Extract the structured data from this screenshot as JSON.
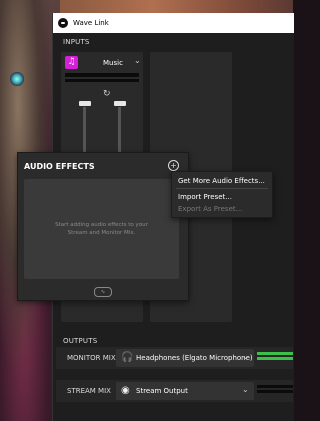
{
  "window": {
    "title": "Wave Link"
  },
  "sections": {
    "inputs": "INPUTS",
    "outputs": "OUTPUTS"
  },
  "input_channel": {
    "name": "Music",
    "icon": "music-note-icon",
    "accent": "#d81fd8"
  },
  "audio_effects": {
    "title": "AUDIO EFFECTS",
    "hint": "Start adding audio effects to your Stream and Monitor Mix."
  },
  "context_menu": {
    "items": [
      {
        "label": "Get More Audio Effects...",
        "enabled": true
      },
      {
        "label": "Import Preset...",
        "enabled": true
      },
      {
        "label": "Export As Preset...",
        "enabled": false
      }
    ]
  },
  "outputs": {
    "monitor_mix": {
      "label": "MONITOR MIX",
      "device": "Headphones (Elgato Microphone)",
      "icon": "headphones-icon",
      "level": 1.0,
      "meter_color": "#3bc04a"
    },
    "stream_mix": {
      "label": "STREAM MIX",
      "device": "Stream Output",
      "icon": "broadcast-icon",
      "level": 0.0
    }
  },
  "colors": {
    "accent": "#d81fd8",
    "meter_green": "#3bc04a",
    "window_bg": "#1e1e1e"
  }
}
